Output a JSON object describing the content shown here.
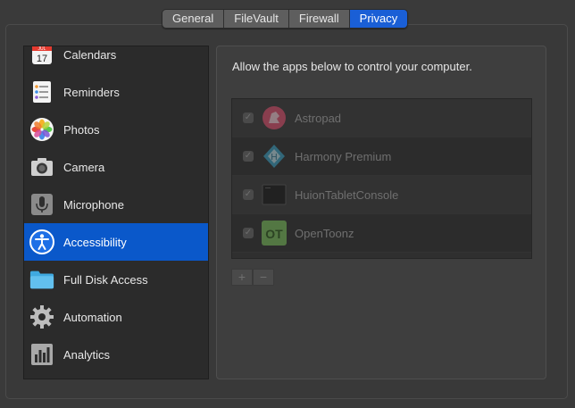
{
  "tabs": [
    {
      "label": "General",
      "active": false
    },
    {
      "label": "FileVault",
      "active": false
    },
    {
      "label": "Firewall",
      "active": false
    },
    {
      "label": "Privacy",
      "active": true
    }
  ],
  "sidebar": {
    "items": [
      {
        "label": "Calendars",
        "icon": "calendar-icon",
        "calendar_month": "JUL",
        "calendar_day": "17"
      },
      {
        "label": "Reminders",
        "icon": "reminders-icon"
      },
      {
        "label": "Photos",
        "icon": "photos-icon"
      },
      {
        "label": "Camera",
        "icon": "camera-icon"
      },
      {
        "label": "Microphone",
        "icon": "microphone-icon"
      },
      {
        "label": "Accessibility",
        "icon": "accessibility-icon",
        "active": true
      },
      {
        "label": "Full Disk Access",
        "icon": "folder-icon"
      },
      {
        "label": "Automation",
        "icon": "gear-icon"
      },
      {
        "label": "Analytics",
        "icon": "analytics-icon"
      }
    ]
  },
  "content": {
    "description": "Allow the apps below to control your computer.",
    "apps": [
      {
        "name": "Astropad",
        "checked": true,
        "icon": "astropad-icon"
      },
      {
        "name": "Harmony Premium",
        "checked": true,
        "icon": "harmony-icon",
        "icon_letter": "H"
      },
      {
        "name": "HuionTabletConsole",
        "checked": true,
        "icon": "huion-icon"
      },
      {
        "name": "OpenToonz",
        "checked": true,
        "icon": "opentoonz-icon",
        "icon_letters": "OT"
      }
    ],
    "add_label": "+",
    "remove_label": "−"
  },
  "colors": {
    "accent": "#0a58ca",
    "tab_active": "#1a5fd6"
  }
}
